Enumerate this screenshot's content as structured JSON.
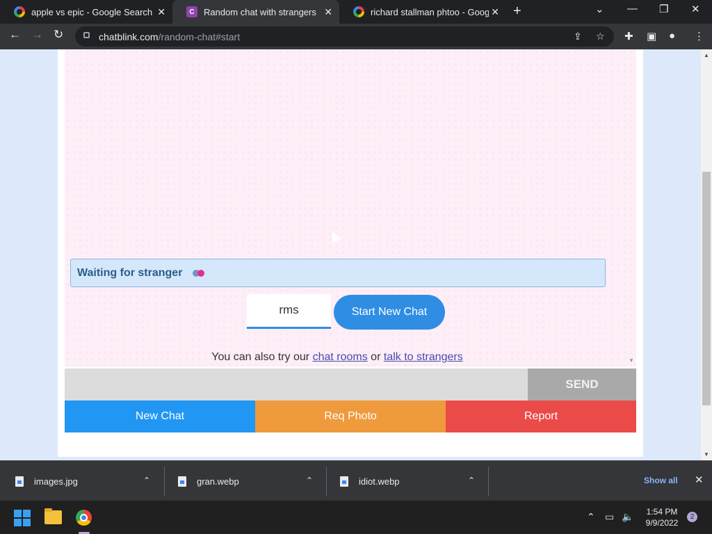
{
  "browser": {
    "tabs": [
      {
        "title": "apple vs epic - Google Search",
        "favicon": "google-icon",
        "active": false
      },
      {
        "title": "Random chat with strangers",
        "favicon": "chatblink-icon",
        "active": true
      },
      {
        "title": "richard stallman phtoo - Google",
        "favicon": "google-icon",
        "active": false
      }
    ],
    "new_tab_glyph": "+",
    "url_host": "chatblink.com",
    "url_path": "/random-chat#start"
  },
  "page": {
    "status_text": "Waiting for stranger",
    "interest_value": "rms",
    "start_button": "Start New Chat",
    "also_try_prefix": "You can also try our",
    "chat_rooms_link": "chat rooms",
    "or_text": "or",
    "talk_to_strangers_link": "talk to strangers",
    "send_button": "SEND",
    "new_chat_button": "New Chat",
    "req_photo_button": "Req Photo",
    "report_button": "Report",
    "colors": {
      "new_chat": "#2196f3",
      "req_photo": "#ef9a3c",
      "report": "#eb4b48",
      "start_button": "#2f8de4"
    }
  },
  "downloads": {
    "items": [
      {
        "name": "images.jpg"
      },
      {
        "name": "gran.webp"
      },
      {
        "name": "idiot.webp"
      }
    ],
    "show_all": "Show all"
  },
  "taskbar": {
    "time": "1:54 PM",
    "date": "9/9/2022",
    "notification_count": "2"
  }
}
